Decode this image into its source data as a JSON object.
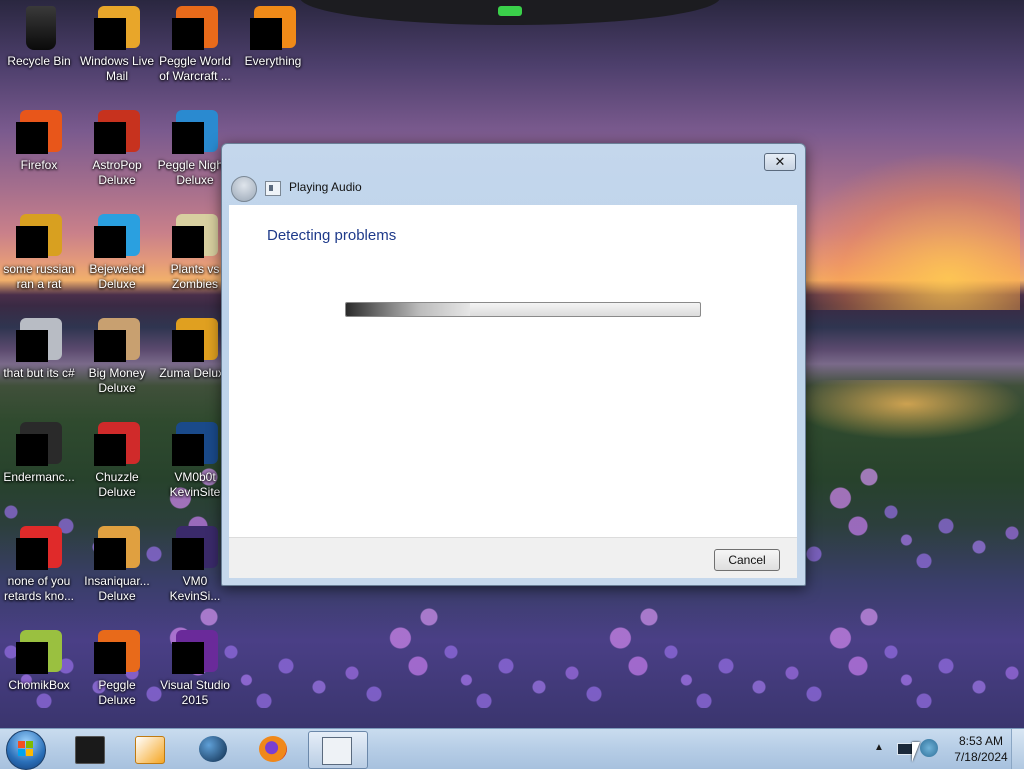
{
  "desktop": {
    "icons": [
      {
        "label": "Recycle Bin",
        "icon": "recycle-bin-icon",
        "color": "#1a1a1a"
      },
      {
        "label": "Windows Live Mail",
        "icon": "mail-icon",
        "color": "#e8a62a"
      },
      {
        "label": "Peggle World of Warcraft ...",
        "icon": "peggle-icon",
        "color": "#e86a1a"
      },
      {
        "label": "Everything",
        "icon": "everything-icon",
        "color": "#f08a18"
      },
      {
        "label": "Firefox",
        "icon": "firefox-icon",
        "color": "#e8561a"
      },
      {
        "label": "AstroPop Deluxe",
        "icon": "astropop-icon",
        "color": "#c7321e"
      },
      {
        "label": "Peggle Nights Deluxe",
        "icon": "peggle-nights-icon",
        "color": "#2a8ad0"
      },
      {
        "label": "some russian ran a rat",
        "icon": "app-icon",
        "color": "#d8a020"
      },
      {
        "label": "Bejeweled Deluxe",
        "icon": "bejeweled-icon",
        "color": "#2aa0e0"
      },
      {
        "label": "Plants vs Zombies",
        "icon": "pvz-icon",
        "color": "#d8d0a0"
      },
      {
        "label": "that but its c#",
        "icon": "files-icon",
        "color": "#b8bcc4"
      },
      {
        "label": "Big Money Deluxe",
        "icon": "bigmoney-icon",
        "color": "#c8a070"
      },
      {
        "label": "Zuma Deluxe",
        "icon": "zuma-icon",
        "color": "#e0a020"
      },
      {
        "label": "Endermanc...",
        "icon": "terminal-icon",
        "color": "#2a2a2a"
      },
      {
        "label": "Chuzzle Deluxe",
        "icon": "chuzzle-icon",
        "color": "#d02a2a"
      },
      {
        "label": "VM0b0t KevinSite",
        "icon": "vm-icon",
        "color": "#1a4a8a"
      },
      {
        "label": "none of you retards kno...",
        "icon": "opera-icon",
        "color": "#e02a2a"
      },
      {
        "label": "Insaniquar... Deluxe",
        "icon": "insaniquarium-icon",
        "color": "#e0a040"
      },
      {
        "label": "VM0 KevinSi...",
        "icon": "vm-icon",
        "color": "#3a2a6a"
      },
      {
        "label": "ChomikBox",
        "icon": "chomikbox-icon",
        "color": "#9ac040"
      },
      {
        "label": "Peggle Deluxe",
        "icon": "peggle-icon",
        "color": "#e86a1a"
      },
      {
        "label": "Visual Studio 2015",
        "icon": "visual-studio-icon",
        "color": "#6a2a9a"
      }
    ]
  },
  "dialog": {
    "title": "Playing Audio",
    "heading": "Detecting problems",
    "close_label": "✕",
    "cancel_label": "Cancel",
    "progress": 0.35
  },
  "taskbar": {
    "items": [
      {
        "name": "start-button",
        "icon": "windows-icon"
      },
      {
        "name": "taskbar-item-terminal",
        "icon": "terminal-icon"
      },
      {
        "name": "taskbar-item-media-player",
        "icon": "media-player-icon"
      },
      {
        "name": "taskbar-item-globe",
        "icon": "globe-icon"
      },
      {
        "name": "taskbar-item-firefox",
        "icon": "firefox-icon"
      },
      {
        "name": "taskbar-item-troubleshooter",
        "icon": "troubleshooter-icon",
        "active": true
      }
    ],
    "clock": {
      "time": "8:53 AM",
      "date": "7/18/2024"
    },
    "tray_arrow": "▲"
  }
}
